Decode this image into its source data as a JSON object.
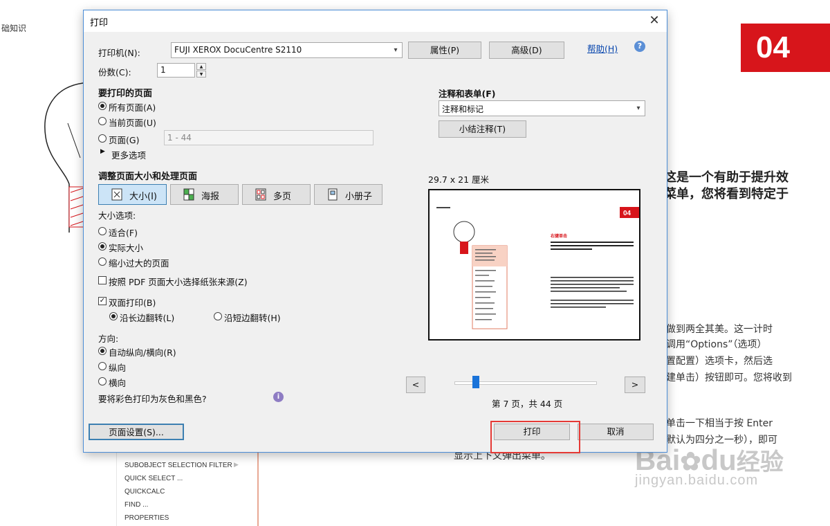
{
  "background": {
    "corner_text": "础知识",
    "badge": "04",
    "heading_lines": [
      "这是一个有助于提升效",
      "菜单，您将看到特定于"
    ],
    "paragraph_lines": [
      "做到两全其美。这一计时",
      "调用“Options”（选项）",
      "置配置）选项卡，然后选",
      "建单击）按钮即可。您将收到"
    ],
    "paragraph2_lines": [
      "单击一下相当于按 Enter",
      "默认为四分之一秒），即可"
    ],
    "bottom_line": "显示上下文弹出菜单。",
    "menu_items": [
      "SUBOBJECT SELECTION FILTER",
      "QUICK SELECT ...",
      "QUICKCALC",
      "FIND ...",
      "PROPERTIES"
    ],
    "watermark_brand": "Bai",
    "watermark_brand2": "du",
    "watermark_cn": "经验",
    "watermark_url": "jingyan.baidu.com"
  },
  "dialog": {
    "title": "打印",
    "close_icon": "close-icon",
    "printer_label": "打印机(N):",
    "printer_value": "FUJI XEROX DocuCentre S2110",
    "properties_button": "属性(P)",
    "advanced_button": "高级(D)",
    "help_link": "帮助(H)",
    "copies_label": "份数(C):",
    "copies_value": "1",
    "pages_section": "要打印的页面",
    "all_pages": "所有页面(A)",
    "current_page": "当前页面(U)",
    "pages_option": "页面(G)",
    "pages_placeholder": "1 - 44",
    "more_options": "更多选项",
    "annotations_section": "注释和表单(F)",
    "annotations_value": "注释和标记",
    "summarize_button": "小结注释(T)",
    "sizing_section": "调整页面大小和处理页面",
    "tabs": [
      {
        "label": "大小(I)",
        "icon": "size-icon"
      },
      {
        "label": "海报",
        "icon": "poster-icon"
      },
      {
        "label": "多页",
        "icon": "multiple-pages-icon"
      },
      {
        "label": "小册子",
        "icon": "booklet-icon"
      }
    ],
    "size_options_label": "大小选项:",
    "fit": "适合(F)",
    "actual_size": "实际大小",
    "shrink": "缩小过大的页面",
    "paper_source": "按照 PDF 页面大小选择纸张来源(Z)",
    "duplex": "双面打印(B)",
    "flip_long": "沿长边翻转(L)",
    "flip_short": "沿短边翻转(H)",
    "orientation_label": "方向:",
    "auto_orientation": "自动纵向/横向(R)",
    "portrait": "纵向",
    "landscape": "横向",
    "grayscale_question": "要将彩色打印为灰色和黑色?",
    "paper_size": "29.7 x 21 厘米",
    "preview": {
      "badge": "04",
      "heading": "右键单击"
    },
    "page_info": "第 7 页，共 44 页",
    "slider_position": 0.16,
    "prev_button": "<",
    "next_button": ">",
    "page_setup_button": "页面设置(S)...",
    "print_button": "打印",
    "cancel_button": "取消",
    "colors": {
      "accent": "#4a8cd6",
      "highlight": "#d7151b"
    }
  }
}
